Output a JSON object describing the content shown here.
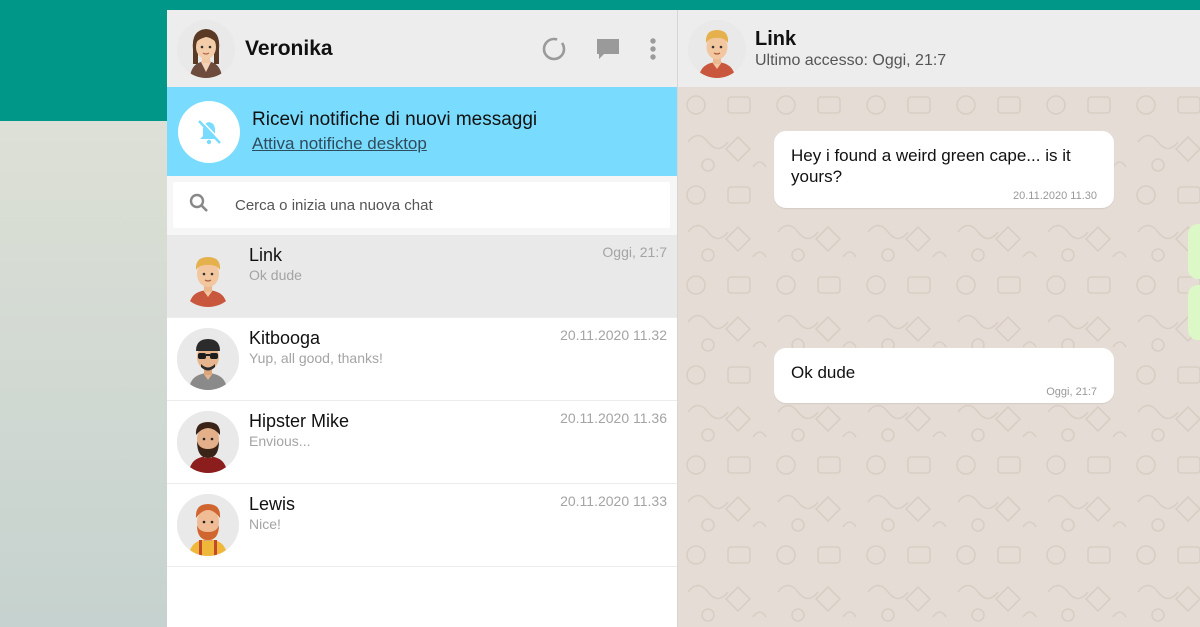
{
  "me": {
    "name": "Veronika"
  },
  "notification": {
    "title": "Ricevi notifiche di nuovi messaggi",
    "link": "Attiva notifiche desktop"
  },
  "search": {
    "placeholder": "Cerca o inizia una nuova chat"
  },
  "chats": [
    {
      "name": "Link",
      "preview": "Ok dude",
      "time": "Oggi, 21:7"
    },
    {
      "name": "Kitbooga",
      "preview": "Yup, all good, thanks!",
      "time": "20.11.2020 11.32"
    },
    {
      "name": "Hipster Mike",
      "preview": "Envious...",
      "time": "20.11.2020 11.36"
    },
    {
      "name": "Lewis",
      "preview": "Nice!",
      "time": "20.11.2020 11.33"
    }
  ],
  "conversation": {
    "contact": "Link",
    "status": "Ultimo accesso: Oggi, 21:7",
    "messages": [
      {
        "text": "Hey i found a weird green cape... is it yours?",
        "time": "20.11.2020 11.30"
      },
      {
        "text": "Ok dude",
        "time": "Oggi, 21:7"
      }
    ]
  },
  "colors": {
    "accent": "#009788",
    "notification_bg": "#79dbfe",
    "chat_bg": "#e5ddd5",
    "header_bg": "#ededed",
    "outgoing_bubble": "#dcf8c6"
  },
  "icons": [
    "status-icon",
    "chat-icon",
    "menu-icon",
    "bell-off-icon",
    "search-icon"
  ]
}
